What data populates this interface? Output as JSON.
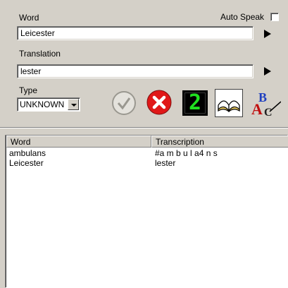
{
  "form": {
    "word_label": "Word",
    "auto_speak_label": "Auto Speak",
    "word_value": "Leicester",
    "translation_label": "Translation",
    "translation_value": "lester",
    "type_label": "Type",
    "type_selected": "UNKNOWN"
  },
  "toolbar": {
    "counter_value": "2",
    "icons": [
      "check-disabled-icon",
      "cancel-icon",
      "counter-display-icon",
      "dictionary-book-icon",
      "spell-check-icon"
    ]
  },
  "list": {
    "columns": [
      "Word",
      "Transcription"
    ],
    "rows": [
      {
        "word": "ambulans",
        "transcription": "#a m b u l a4 n s"
      },
      {
        "word": "Leicester",
        "transcription": "lester"
      }
    ]
  },
  "colors": {
    "window_bg": "#d4d0c8",
    "cancel_red": "#e01818",
    "counter_green": "#20e020"
  }
}
